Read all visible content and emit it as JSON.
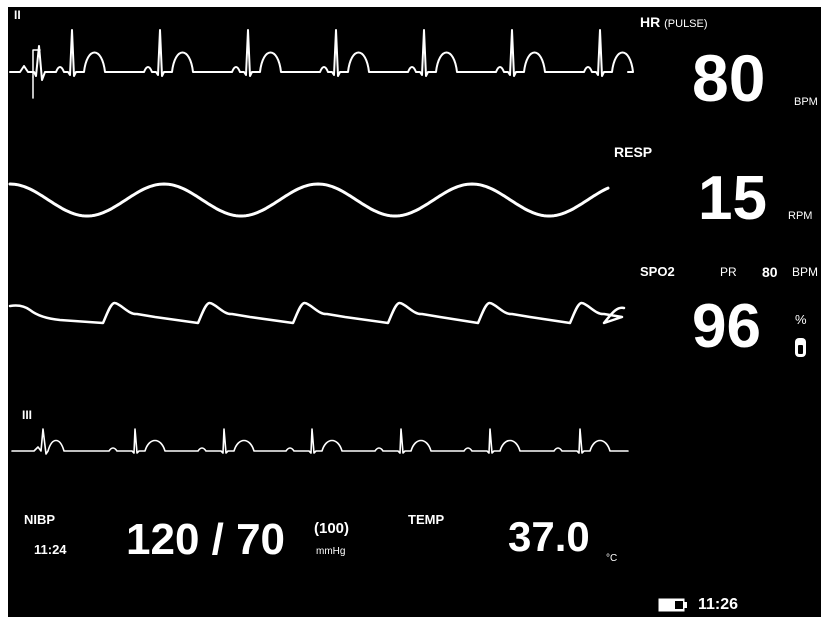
{
  "waveforms": {
    "ecg_top": {
      "lead": "II"
    },
    "resp": {},
    "pleth": {},
    "ecg_bottom": {
      "lead": "III"
    }
  },
  "hr": {
    "label": "HR",
    "source": "(PULSE)",
    "value": "80",
    "unit": "BPM"
  },
  "resp": {
    "label": "RESP",
    "value": "15",
    "unit": "RPM"
  },
  "spo2": {
    "label": "SPO2",
    "pr_label": "PR",
    "pr_value": "80",
    "pr_unit": "BPM",
    "value": "96",
    "unit": "%"
  },
  "nibp": {
    "label": "NIBP",
    "time": "11:24",
    "value": "120 / 70",
    "mean": "(100)",
    "unit": "mmHg"
  },
  "temp": {
    "label": "TEMP",
    "value": "37.0",
    "unit": "°C"
  },
  "status": {
    "battery_icon": "battery-icon",
    "clock": "11:26"
  },
  "colors": {
    "background": "#000000",
    "foreground": "#ffffff"
  }
}
